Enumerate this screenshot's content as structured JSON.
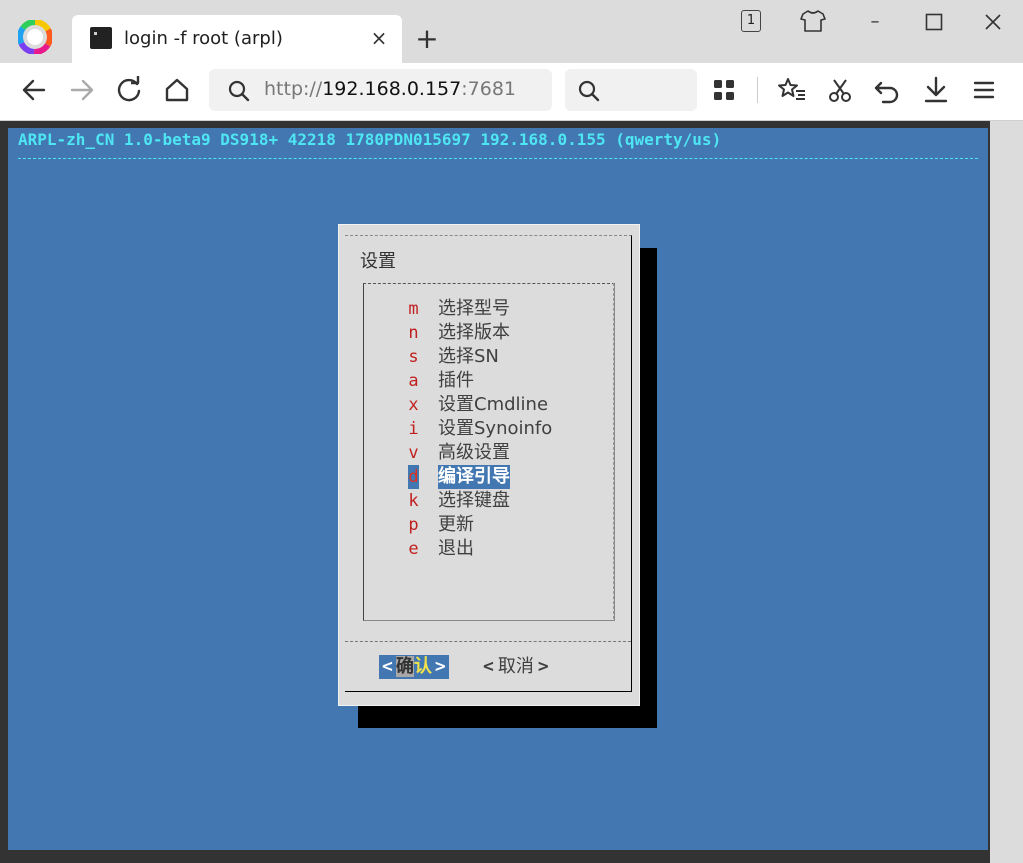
{
  "tab": {
    "title": "login -f root (arpl)",
    "close_glyph": "×"
  },
  "new_tab_glyph": "+",
  "window": {
    "tab_count": "1",
    "tshirt_icon": "tshirt-icon",
    "minimize_glyph": "–",
    "maximize_glyph": "☐",
    "close_glyph": "✕"
  },
  "toolbar": {
    "url_prefix": "http://",
    "url_host": "192.168.0.157",
    "url_port": ":7681",
    "search_value": ""
  },
  "terminal": {
    "status_line": "ARPL-zh_CN 1.0-beta9 DS918+ 42218 1780PDN015697 192.168.0.155 (qwerty/us)",
    "colors": {
      "background": "#4277b1",
      "status": "#4ee6f3",
      "dialog": "#dcdcdc",
      "hotkey": "#c02020"
    }
  },
  "dialog": {
    "title": "设置",
    "items": [
      {
        "key": "m",
        "label": "选择型号"
      },
      {
        "key": "n",
        "label": "选择版本"
      },
      {
        "key": "s",
        "label": "选择SN"
      },
      {
        "key": "a",
        "label": "插件"
      },
      {
        "key": "x",
        "label": "设置Cmdline"
      },
      {
        "key": "i",
        "label": "设置Synoinfo"
      },
      {
        "key": "v",
        "label": "高级设置"
      },
      {
        "key": "d",
        "label": "编译引导",
        "selected": true
      },
      {
        "key": "k",
        "label": "选择键盘"
      },
      {
        "key": "p",
        "label": "更新"
      },
      {
        "key": "e",
        "label": "退出"
      }
    ],
    "ok": {
      "left_arrow": "<",
      "char1": "确",
      "char2": "认",
      "right_arrow": ">"
    },
    "cancel": {
      "left_arrow": "<",
      "label": "取消",
      "right_arrow": ">"
    }
  }
}
